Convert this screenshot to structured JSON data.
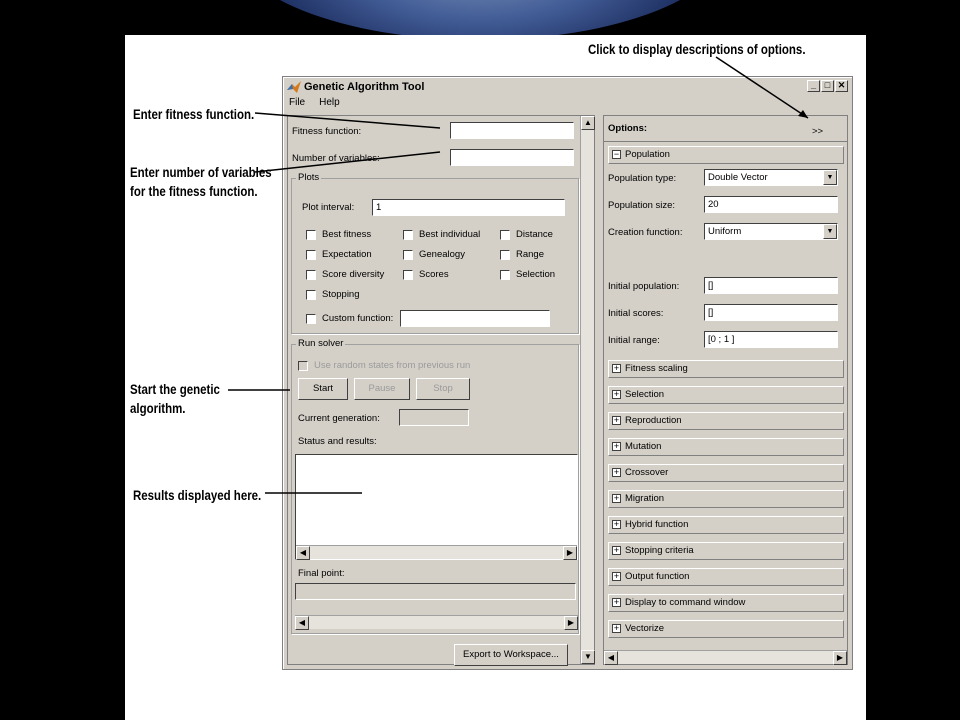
{
  "callouts": {
    "descriptions": "Click to display descriptions of options.",
    "fitness": "Enter fitness function.",
    "numvars_line1": "Enter number of variables",
    "numvars_line2": "for the fitness function.",
    "start_line1": "Start the genetic",
    "start_line2": "algorithm.",
    "results": "Results displayed here."
  },
  "window": {
    "title": "Genetic Algorithm Tool",
    "menu": [
      "File",
      "Help"
    ]
  },
  "left": {
    "fitness_label": "Fitness function:",
    "fitness_value": "",
    "numvars_label": "Number of variables:",
    "numvars_value": "",
    "plots": {
      "title": "Plots",
      "interval_label": "Plot interval:",
      "interval_value": "1",
      "checkboxes": [
        "Best fitness",
        "Best individual",
        "Distance",
        "Expectation",
        "Genealogy",
        "Range",
        "Score diversity",
        "Scores",
        "Selection",
        "Stopping"
      ],
      "custom_label": "Custom function:",
      "custom_value": ""
    },
    "run": {
      "title": "Run solver",
      "random_states": "Use random states from previous run",
      "start": "Start",
      "pause": "Pause",
      "stop": "Stop",
      "generation_label": "Current generation:",
      "status_label": "Status and results:",
      "final_label": "Final point:"
    },
    "export": "Export to Workspace..."
  },
  "right": {
    "options_label": "Options:",
    "more": ">>",
    "population": {
      "title": "Population",
      "type_label": "Population type:",
      "type_value": "Double Vector",
      "size_label": "Population size:",
      "size_value": "20",
      "creation_label": "Creation function:",
      "creation_value": "Uniform",
      "init_pop_label": "Initial population:",
      "init_pop_value": "[]",
      "init_scores_label": "Initial scores:",
      "init_scores_value": "[]",
      "init_range_label": "Initial range:",
      "init_range_value": "[0 ; 1 ]"
    },
    "sections": [
      "Fitness scaling",
      "Selection",
      "Reproduction",
      "Mutation",
      "Crossover",
      "Migration",
      "Hybrid function",
      "Stopping criteria",
      "Output function",
      "Display to command window",
      "Vectorize"
    ]
  },
  "icons": {
    "minimize": "minimize-icon",
    "maximize": "maximize-icon",
    "close": "close-icon",
    "collapse": "minus-icon",
    "expand": "plus-icon"
  }
}
